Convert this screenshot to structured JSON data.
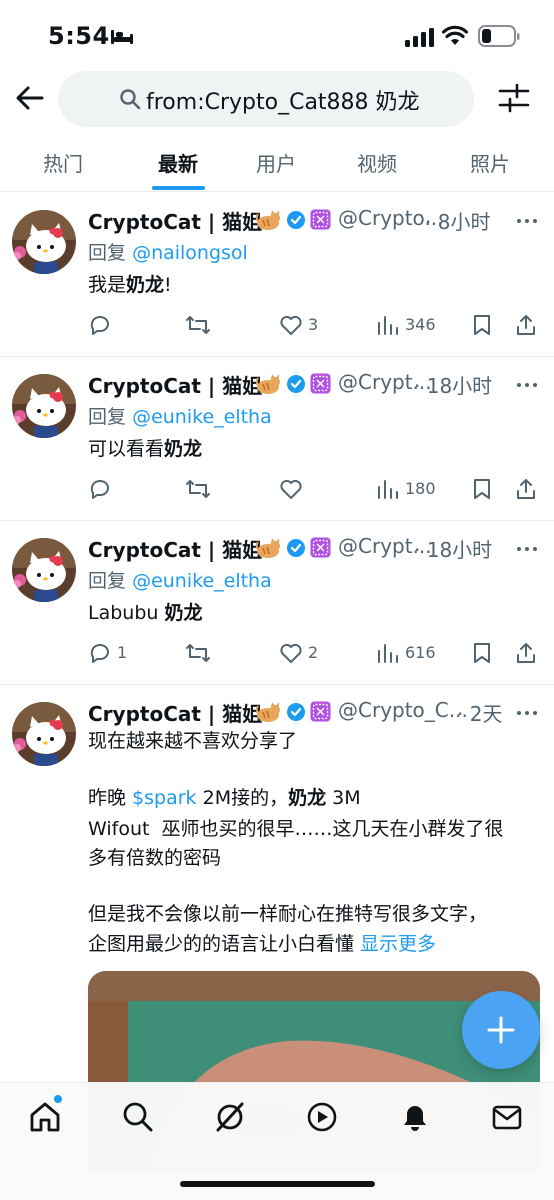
{
  "status_bar": {
    "time": "5:54",
    "icons": [
      "sleep-bed-icon",
      "cellular-signal-icon",
      "wifi-icon",
      "battery-icon"
    ]
  },
  "search": {
    "query": "from:Crypto_Cat888 奶龙"
  },
  "tabs": [
    {
      "label": "热门",
      "active": false
    },
    {
      "label": "最新",
      "active": true
    },
    {
      "label": "用户",
      "active": false
    },
    {
      "label": "视频",
      "active": false
    },
    {
      "label": "照片",
      "active": false
    }
  ],
  "accent_color": "#1d9bf0",
  "tweets": [
    {
      "display_name": "CryptoCat | 猫姐",
      "handle": "@Crypto...",
      "time": "· 8小时",
      "reply_prefix": "回复",
      "reply_to": "@nailongsol",
      "text_plain": "我是",
      "text_bold": "奶龙",
      "text_after": "!",
      "replies": "",
      "retweets": "",
      "likes": "3",
      "views": "346"
    },
    {
      "display_name": "CryptoCat | 猫姐",
      "handle": "@Crypt...",
      "time": "· 18小时",
      "reply_prefix": "回复",
      "reply_to": "@eunike_eltha",
      "text_plain": "可以看看",
      "text_bold": "奶龙",
      "text_after": "",
      "replies": "",
      "retweets": "",
      "likes": "",
      "views": "180"
    },
    {
      "display_name": "CryptoCat | 猫姐",
      "handle": "@Crypt...",
      "time": "· 18小时",
      "reply_prefix": "回复",
      "reply_to": "@eunike_eltha",
      "text_plain": "Labubu ",
      "text_bold": "奶龙",
      "text_after": "",
      "replies": "1",
      "retweets": "",
      "likes": "2",
      "views": "616"
    },
    {
      "display_name": "CryptoCat | 猫姐",
      "handle": "@Crypto_C...",
      "time": "· 2天",
      "line1": "现在越来越不喜欢分享了",
      "line2_a": "昨晚 ",
      "line2_link": "$spark",
      "line2_b": " 2M接的，",
      "line2_bold": "奶龙",
      "line2_c": " 3M",
      "line3": "Wifout  巫师也买的很早……这几天在小群发了很",
      "line4": "多有倍数的密码",
      "line5": "但是我不会像以前一样耐心在推特写很多文字，",
      "line6": "企图用最少的的语言让小白看懂 ",
      "show_more": "显示更多"
    }
  ],
  "bottom_nav": [
    {
      "name": "home-icon",
      "active": true
    },
    {
      "name": "search-icon"
    },
    {
      "name": "grok-icon"
    },
    {
      "name": "video-play-icon"
    },
    {
      "name": "notifications-bell-icon"
    },
    {
      "name": "messages-mail-icon"
    }
  ],
  "fab": {
    "icon": "plus-icon"
  }
}
